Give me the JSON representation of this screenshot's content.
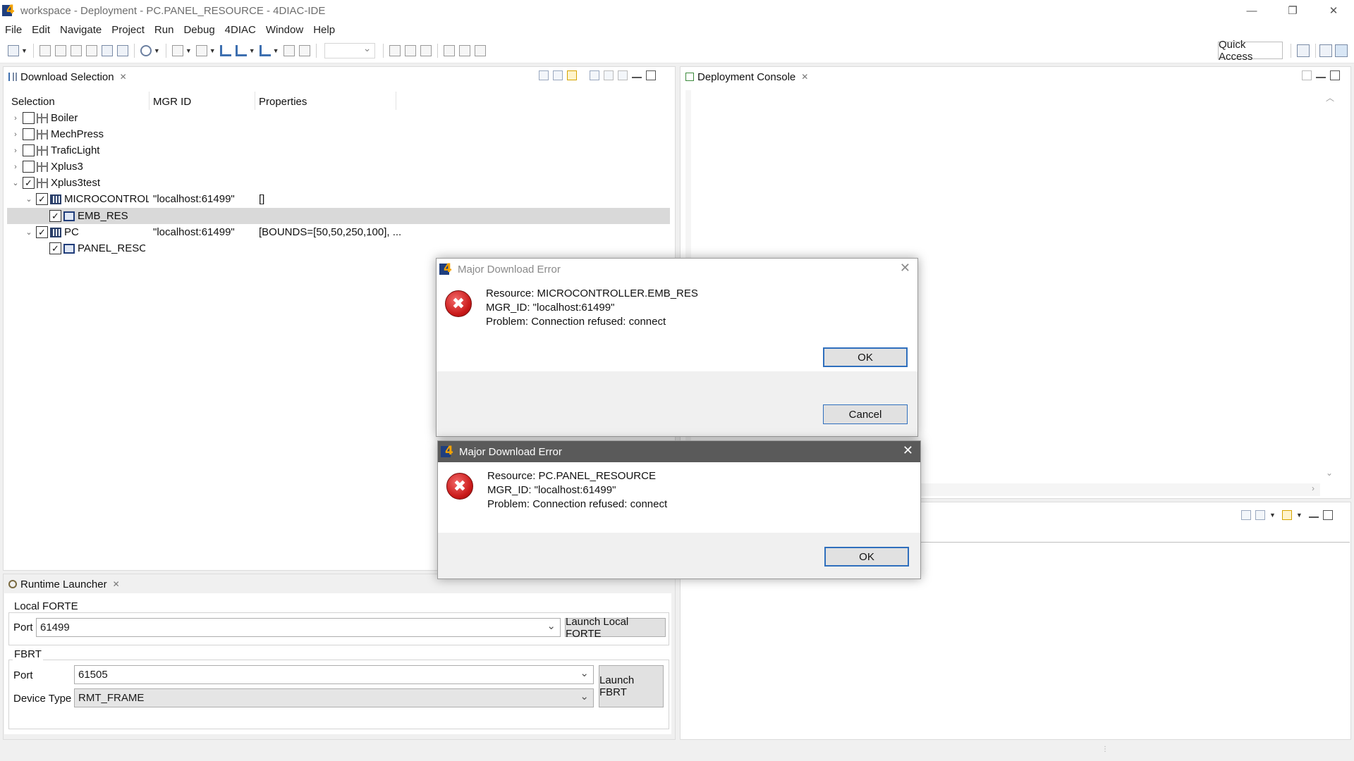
{
  "window": {
    "title": "workspace - Deployment - PC.PANEL_RESOURCE - 4DIAC-IDE",
    "minimize": "—",
    "restore": "❐",
    "close": "✕"
  },
  "menu": [
    "File",
    "Edit",
    "Navigate",
    "Project",
    "Run",
    "Debug",
    "4DIAC",
    "Window",
    "Help"
  ],
  "toolbar": {
    "quick_access": "Quick Access"
  },
  "download_selection": {
    "tab_label": "Download Selection",
    "columns": [
      "Selection",
      "MGR ID",
      "Properties"
    ],
    "rows": [
      {
        "label": "Boiler",
        "mgr_id": "",
        "props": "",
        "checked": false
      },
      {
        "label": "MechPress",
        "mgr_id": "",
        "props": "",
        "checked": false
      },
      {
        "label": "TraficLight",
        "mgr_id": "",
        "props": "",
        "checked": false
      },
      {
        "label": "Xplus3",
        "mgr_id": "",
        "props": "",
        "checked": false
      },
      {
        "label": "Xplus3test",
        "mgr_id": "",
        "props": "",
        "checked": true
      },
      {
        "label": "MICROCONTROLL",
        "mgr_id": "\"localhost:61499\"",
        "props": "[]",
        "checked": true
      },
      {
        "label": "EMB_RES",
        "mgr_id": "",
        "props": "",
        "checked": true
      },
      {
        "label": "PC",
        "mgr_id": "\"localhost:61499\"",
        "props": "[BOUNDS=[50,50,250,100], ...",
        "checked": true
      },
      {
        "label": "PANEL_RESOU",
        "mgr_id": "",
        "props": "",
        "checked": true
      }
    ],
    "check_mark": "✓"
  },
  "deployment_console": {
    "tab_label": "Deployment Console"
  },
  "runtime_launcher": {
    "tab_label": "Runtime Launcher",
    "local_forte": {
      "group_label": "Local FORTE",
      "port_label": "Port",
      "port_value": "61499",
      "launch_label": "Launch Local FORTE"
    },
    "fbrt": {
      "group_label": "FBRT",
      "port_label": "Port",
      "port_value": "61505",
      "device_type_label": "Device Type",
      "device_type_value": "RMT_FRAME",
      "launch_label": "Launch FBRT"
    }
  },
  "dialogs": [
    {
      "title": "Major Download Error",
      "resource": "Resource: MICROCONTROLLER.EMB_RES",
      "mgr_id": "MGR_ID: \"localhost:61499\"",
      "problem": "Problem: Connection refused: connect",
      "ok_label": "OK",
      "cancel_label": "Cancel"
    },
    {
      "title": "Major Download Error",
      "resource": "Resource: PC.PANEL_RESOURCE",
      "mgr_id": "MGR_ID: \"localhost:61499\"",
      "problem": "Problem: Connection refused: connect",
      "ok_label": "OK"
    }
  ],
  "icons": {
    "error": "✖",
    "close_tab": "✕",
    "chevron_right": "›",
    "chevron_down": "⌄",
    "dropdown": "⌄"
  },
  "colors": {
    "accent": "#2f6fbd",
    "error": "#c81818",
    "brand_blue": "#1f3f7f",
    "brand_orange": "#f5a300"
  }
}
